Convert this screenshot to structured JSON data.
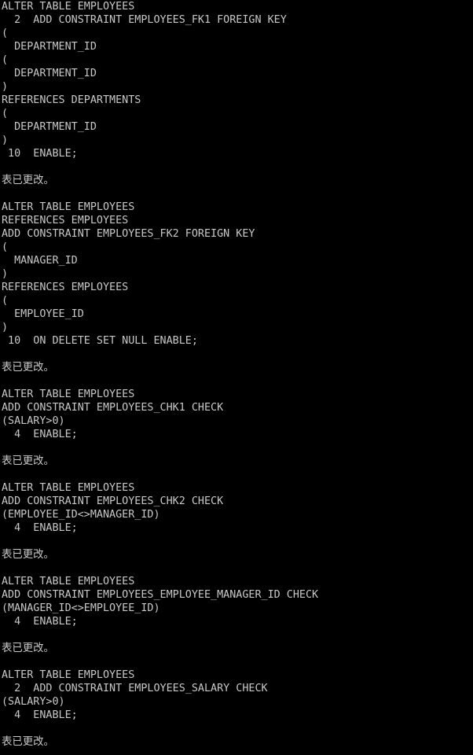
{
  "terminal": {
    "lines": [
      "ALTER TABLE EMPLOYEES",
      "  2  ADD CONSTRAINT EMPLOYEES_FK1 FOREIGN KEY",
      "(",
      "  DEPARTMENT_ID",
      "(",
      "  DEPARTMENT_ID",
      ")",
      "REFERENCES DEPARTMENTS",
      "(",
      "  DEPARTMENT_ID",
      ")",
      " 10  ENABLE;",
      "",
      "表已更改。",
      "",
      "ALTER TABLE EMPLOYEES",
      "REFERENCES EMPLOYEES",
      "ADD CONSTRAINT EMPLOYEES_FK2 FOREIGN KEY",
      "(",
      "  MANAGER_ID",
      ")",
      "REFERENCES EMPLOYEES",
      "(",
      "  EMPLOYEE_ID",
      ")",
      " 10  ON DELETE SET NULL ENABLE;",
      "",
      "表已更改。",
      "",
      "ALTER TABLE EMPLOYEES",
      "ADD CONSTRAINT EMPLOYEES_CHK1 CHECK",
      "(SALARY>0)",
      "  4  ENABLE;",
      "",
      "表已更改。",
      "",
      "ALTER TABLE EMPLOYEES",
      "ADD CONSTRAINT EMPLOYEES_CHK2 CHECK",
      "(EMPLOYEE_ID<>MANAGER_ID)",
      "  4  ENABLE;",
      "",
      "表已更改。",
      "",
      "ALTER TABLE EMPLOYEES",
      "ADD CONSTRAINT EMPLOYEES_EMPLOYEE_MANAGER_ID CHECK",
      "(MANAGER_ID<>EMPLOYEE_ID)",
      "  4  ENABLE;",
      "",
      "表已更改。",
      "",
      "ALTER TABLE EMPLOYEES",
      "  2  ADD CONSTRAINT EMPLOYEES_SALARY CHECK",
      "(SALARY>0)",
      "  4  ENABLE;",
      "",
      "表已更改。"
    ]
  }
}
